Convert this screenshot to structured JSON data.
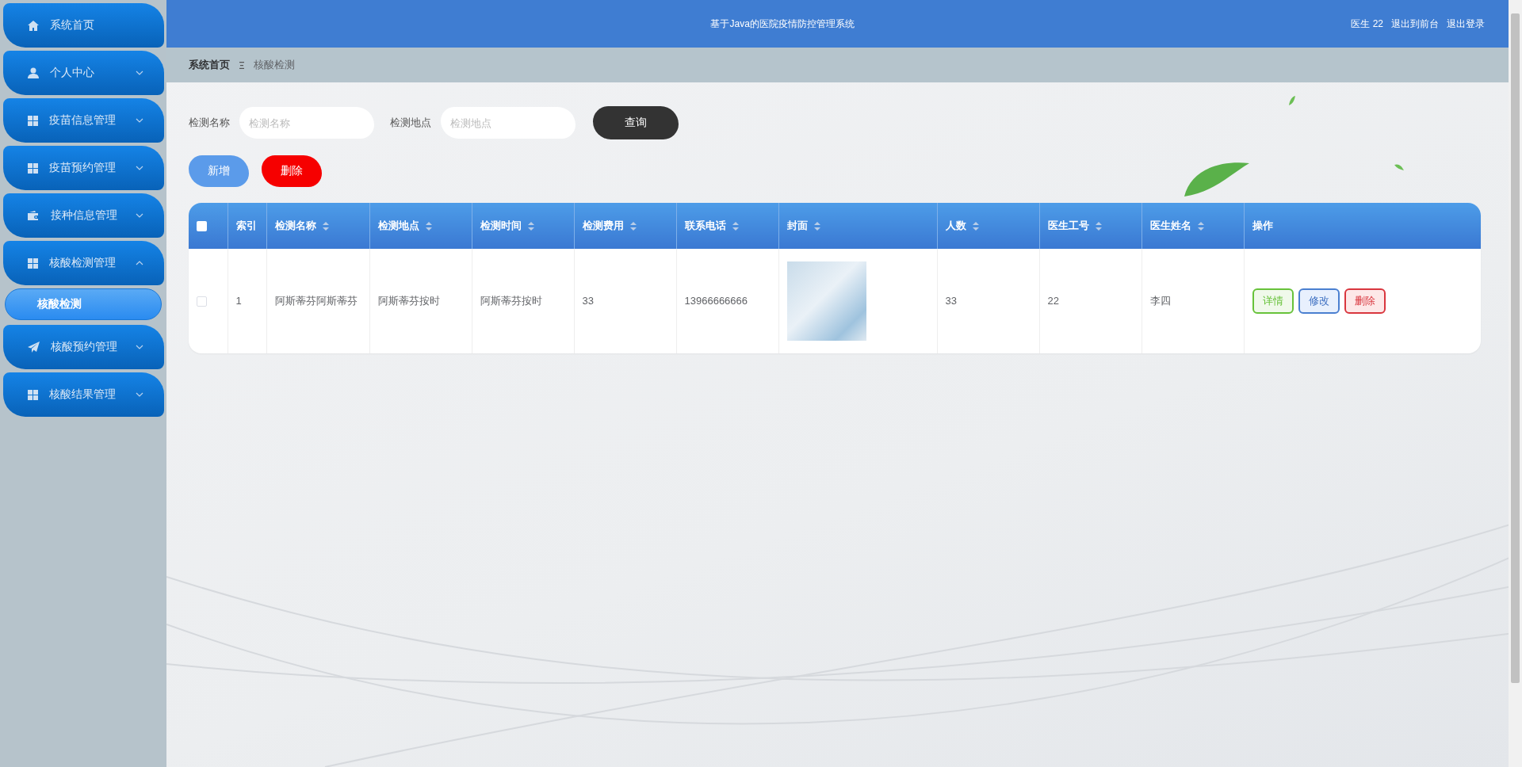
{
  "header": {
    "title": "基于Java的医院疫情防控管理系统",
    "user": "医生 22",
    "links": [
      "退出到前台",
      "退出登录"
    ]
  },
  "sidebar": {
    "items": [
      {
        "label": "系统首页",
        "kind": "link"
      },
      {
        "label": "个人中心",
        "kind": "menu",
        "expanded": false
      },
      {
        "label": "疫苗信息管理",
        "kind": "menu",
        "expanded": false
      },
      {
        "label": "疫苗预约管理",
        "kind": "menu",
        "expanded": false
      },
      {
        "label": "接种信息管理",
        "kind": "menu",
        "expanded": false
      },
      {
        "label": "核酸检测管理",
        "kind": "menu",
        "expanded": true,
        "children": [
          {
            "label": "核酸检测",
            "selected": true
          }
        ]
      },
      {
        "label": "核酸预约管理",
        "kind": "menu",
        "expanded": false
      },
      {
        "label": "核酸结果管理",
        "kind": "menu",
        "expanded": false
      }
    ]
  },
  "breadcrumb": [
    "系统首页",
    "核酸检测"
  ],
  "search": {
    "fields": [
      {
        "label": "检测名称",
        "placeholder": "检测名称"
      },
      {
        "label": "检测地点",
        "placeholder": "检测地点"
      }
    ],
    "button": "查询"
  },
  "actions": [
    {
      "label": "新增",
      "kind": "add"
    },
    {
      "label": "删除",
      "kind": "delete"
    }
  ],
  "table": {
    "select_all": {
      "checked": false
    },
    "columns": [
      {
        "label": "索引",
        "sortable": false
      },
      {
        "label": "检测名称",
        "sortable": true
      },
      {
        "label": "检测地点",
        "sortable": true
      },
      {
        "label": "检测时间",
        "sortable": true
      },
      {
        "label": "检测费用",
        "sortable": true
      },
      {
        "label": "联系电话",
        "sortable": true
      },
      {
        "label": "封面",
        "sortable": true
      },
      {
        "label": "人数",
        "sortable": true
      },
      {
        "label": "医生工号",
        "sortable": true
      },
      {
        "label": "医生姓名",
        "sortable": true
      },
      {
        "label": "操作",
        "sortable": false
      }
    ],
    "rows": [
      {
        "checked": false,
        "cells": [
          "1",
          "阿斯蒂芬阿斯蒂芬",
          "阿斯蒂芬按时",
          "阿斯蒂芬按时",
          "33",
          "13966666666",
          null,
          "33",
          "22",
          "李四"
        ],
        "operations": [
          {
            "label": "详情",
            "kind": "detail"
          },
          {
            "label": "修改",
            "kind": "edit"
          },
          {
            "label": "删除",
            "kind": "delete"
          }
        ]
      }
    ]
  }
}
